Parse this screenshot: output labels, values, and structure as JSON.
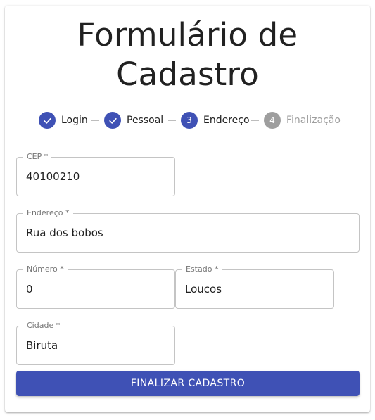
{
  "title_line1": "Formulário de",
  "title_line2": "Cadastro",
  "stepper": {
    "steps": [
      {
        "label": "Login",
        "state": "completed",
        "number": "1"
      },
      {
        "label": "Pessoal",
        "state": "completed",
        "number": "2"
      },
      {
        "label": "Endereço",
        "state": "active",
        "number": "3"
      },
      {
        "label": "Finalização",
        "state": "pending",
        "number": "4"
      }
    ]
  },
  "fields": {
    "cep": {
      "label": "CEP *",
      "value": "40100210"
    },
    "endereco": {
      "label": "Endereço *",
      "value": "Rua dos bobos"
    },
    "numero": {
      "label": "Número *",
      "value": "0"
    },
    "estado": {
      "label": "Estado *",
      "value": "Loucos"
    },
    "cidade": {
      "label": "Cidade *",
      "value": "Biruta"
    }
  },
  "submit_label": "FINALIZAR CADASTRO",
  "colors": {
    "primary": "#3f51b5",
    "inactive": "#9e9e9e",
    "border": "#c4c4c4"
  }
}
